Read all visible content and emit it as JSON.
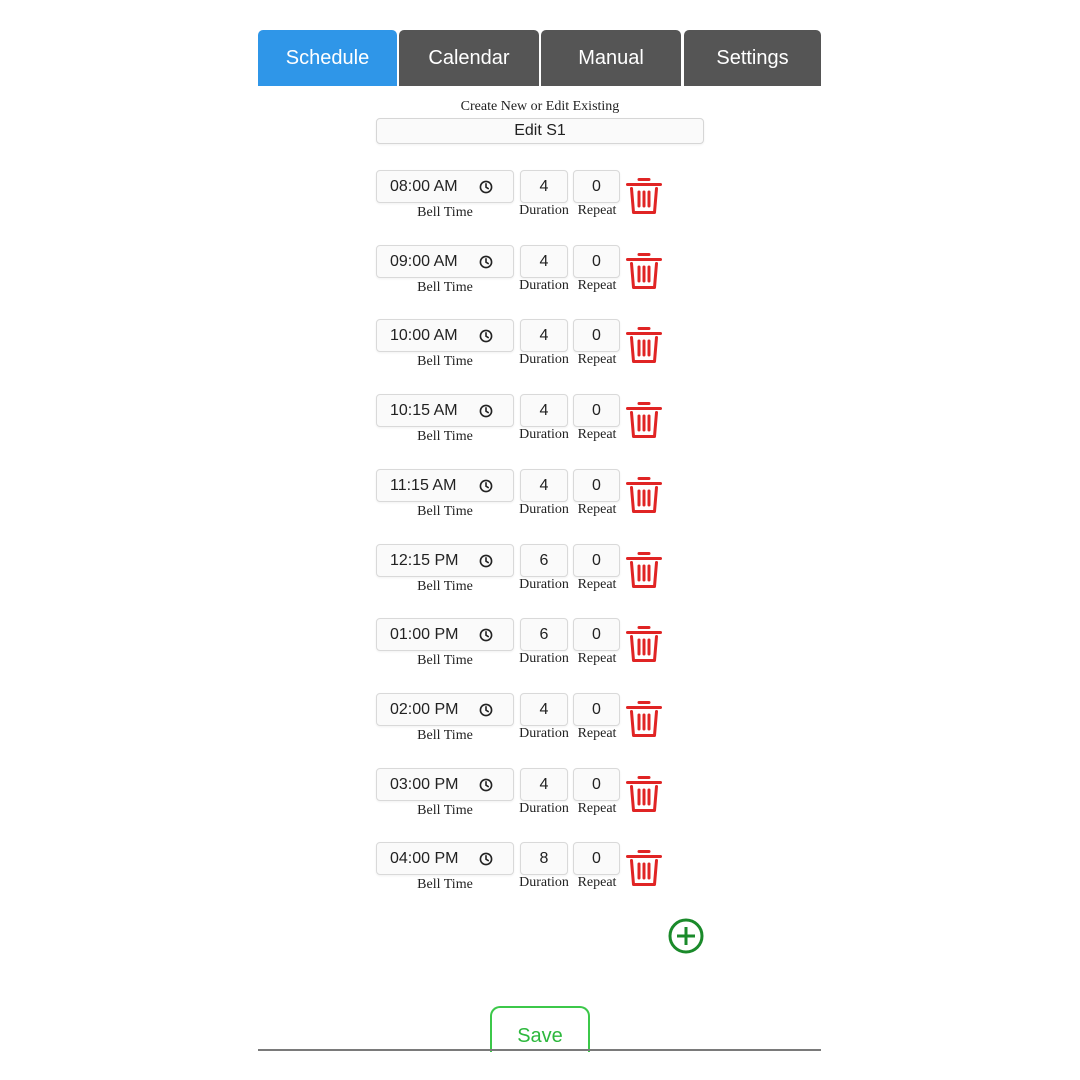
{
  "tabs": [
    {
      "label": "Schedule",
      "active": true
    },
    {
      "label": "Calendar",
      "active": false
    },
    {
      "label": "Manual",
      "active": false
    },
    {
      "label": "Settings",
      "active": false
    }
  ],
  "schedule_name": {
    "label": "Create New or Edit Existing",
    "value": "Edit S1"
  },
  "row_labels": {
    "bell_time": "Bell Time",
    "duration": "Duration",
    "repeat": "Repeat"
  },
  "bells": [
    {
      "time": "08:00 AM",
      "duration": "4",
      "repeat": "0"
    },
    {
      "time": "09:00 AM",
      "duration": "4",
      "repeat": "0"
    },
    {
      "time": "10:00 AM",
      "duration": "4",
      "repeat": "0"
    },
    {
      "time": "10:15 AM",
      "duration": "4",
      "repeat": "0"
    },
    {
      "time": "11:15 AM",
      "duration": "4",
      "repeat": "0"
    },
    {
      "time": "12:15 PM",
      "duration": "6",
      "repeat": "0"
    },
    {
      "time": "01:00 PM",
      "duration": "6",
      "repeat": "0"
    },
    {
      "time": "02:00 PM",
      "duration": "4",
      "repeat": "0"
    },
    {
      "time": "03:00 PM",
      "duration": "4",
      "repeat": "0"
    },
    {
      "time": "04:00 PM",
      "duration": "8",
      "repeat": "0"
    }
  ],
  "icons": {
    "clock": "clock-icon",
    "delete": "trash-icon",
    "add": "plus-circle-icon"
  },
  "save_label": "Save",
  "colors": {
    "active_tab": "#2f96e8",
    "inactive_tab": "#555555",
    "delete": "#e02424",
    "add": "#1a8a2a",
    "save": "#3cc84a"
  }
}
